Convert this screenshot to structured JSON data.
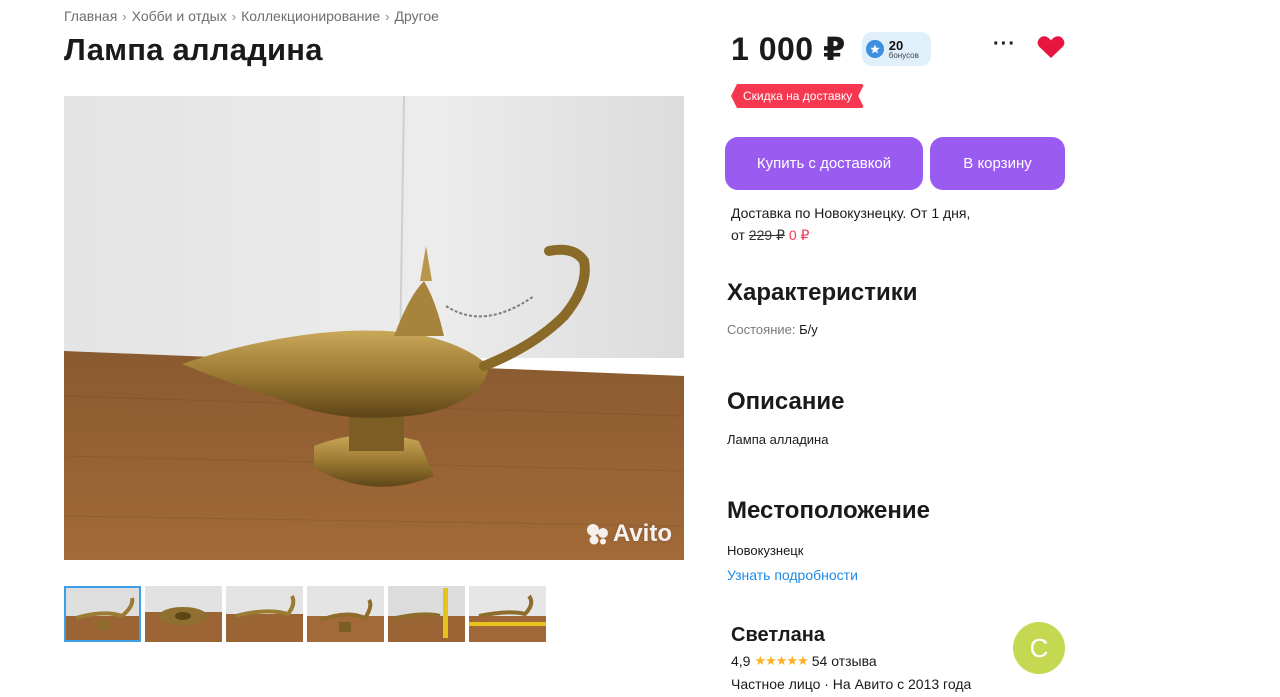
{
  "breadcrumbs": [
    "Главная",
    "Хобби и отдых",
    "Коллекционирование",
    "Другое"
  ],
  "breadcrumb_separator": "›",
  "title": "Лампа алладина",
  "photo": {
    "watermark": "Avito",
    "thumbnail_count": 6,
    "active_thumbnail": 1
  },
  "price": "1 000 ₽",
  "bonus": {
    "amount": "20",
    "label": "бонусов",
    "icon": "bonus-coin-icon",
    "color": "#3f8fe0"
  },
  "actions": {
    "more_label": "···",
    "favorite_icon": "heart-icon",
    "favorite_color": "#e8163f"
  },
  "discount_badge": "Скидка на доставку",
  "buttons": {
    "buy": "Купить с доставкой",
    "cart": "В корзину",
    "color": "#9a5bf0"
  },
  "delivery": {
    "line1": "Доставка по Новокузнецку. От 1 дня,",
    "from_label": "от",
    "old_price": "229 ₽",
    "new_price": "0 ₽"
  },
  "characteristics": {
    "title": "Характеристики",
    "condition_label": "Состояние:",
    "condition_value": "Б/у"
  },
  "description": {
    "title": "Описание",
    "text": "Лампа алладина"
  },
  "location": {
    "title": "Местоположение",
    "city": "Новокузнецк",
    "details_link": "Узнать подробности"
  },
  "seller": {
    "name": "Светлана",
    "rating": "4,9",
    "stars": "★★★★★",
    "reviews": "54 отзыва",
    "info": "Частное лицо · На Авито с 2013 года",
    "avatar_letter": "С",
    "avatar_color": "#c4d852"
  }
}
